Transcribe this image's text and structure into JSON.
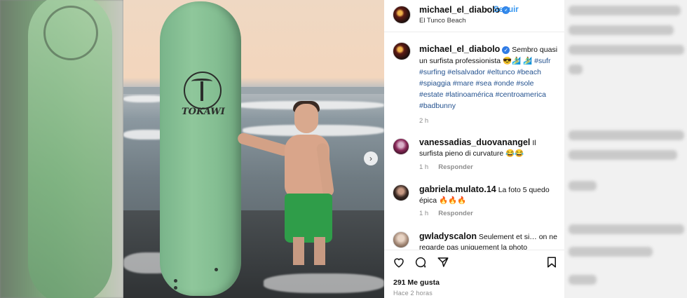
{
  "post": {
    "username": "michael_el_diabolo",
    "follow_label": "Seguir",
    "separator": "•",
    "location": "El Tunco Beach",
    "caption_text": "Sembro quasi un surfista professionista 😎🏄‍♂️",
    "caption_tags": "🏄‍♂️ #sufr #surfing #elsalvador #eltunco #beach #spiaggia #mare #sea #onde #sole #estate #latinoamérica #centroamerica #badbunny",
    "caption_time": "2 h",
    "board_brand": "TOKAWI"
  },
  "comments": [
    {
      "username": "vanessadias_duovanangel",
      "text": "Il surfista pieno di curvature 😂😂",
      "time": "1 h",
      "reply": "Responder"
    },
    {
      "username": "gabriela.mulato.14",
      "text": "La foto 5 quedo épica 🔥🔥🔥",
      "time": "1 h",
      "reply": "Responder"
    },
    {
      "username": "gwladyscalon",
      "text": "Seulement et si… on ne regarde pas uniquement la photo"
    }
  ],
  "footer": {
    "likes": "291 Me gusta",
    "posted_ago": "Hace 2 horas"
  },
  "colors": {
    "link": "#3897f0",
    "hashtag": "#24528f",
    "muted": "#8e8e8e",
    "verified": "#2f7be5"
  },
  "icons": [
    "heart-icon",
    "comment-icon",
    "share-icon",
    "bookmark-icon",
    "chevron-right-icon",
    "verified-icon"
  ]
}
